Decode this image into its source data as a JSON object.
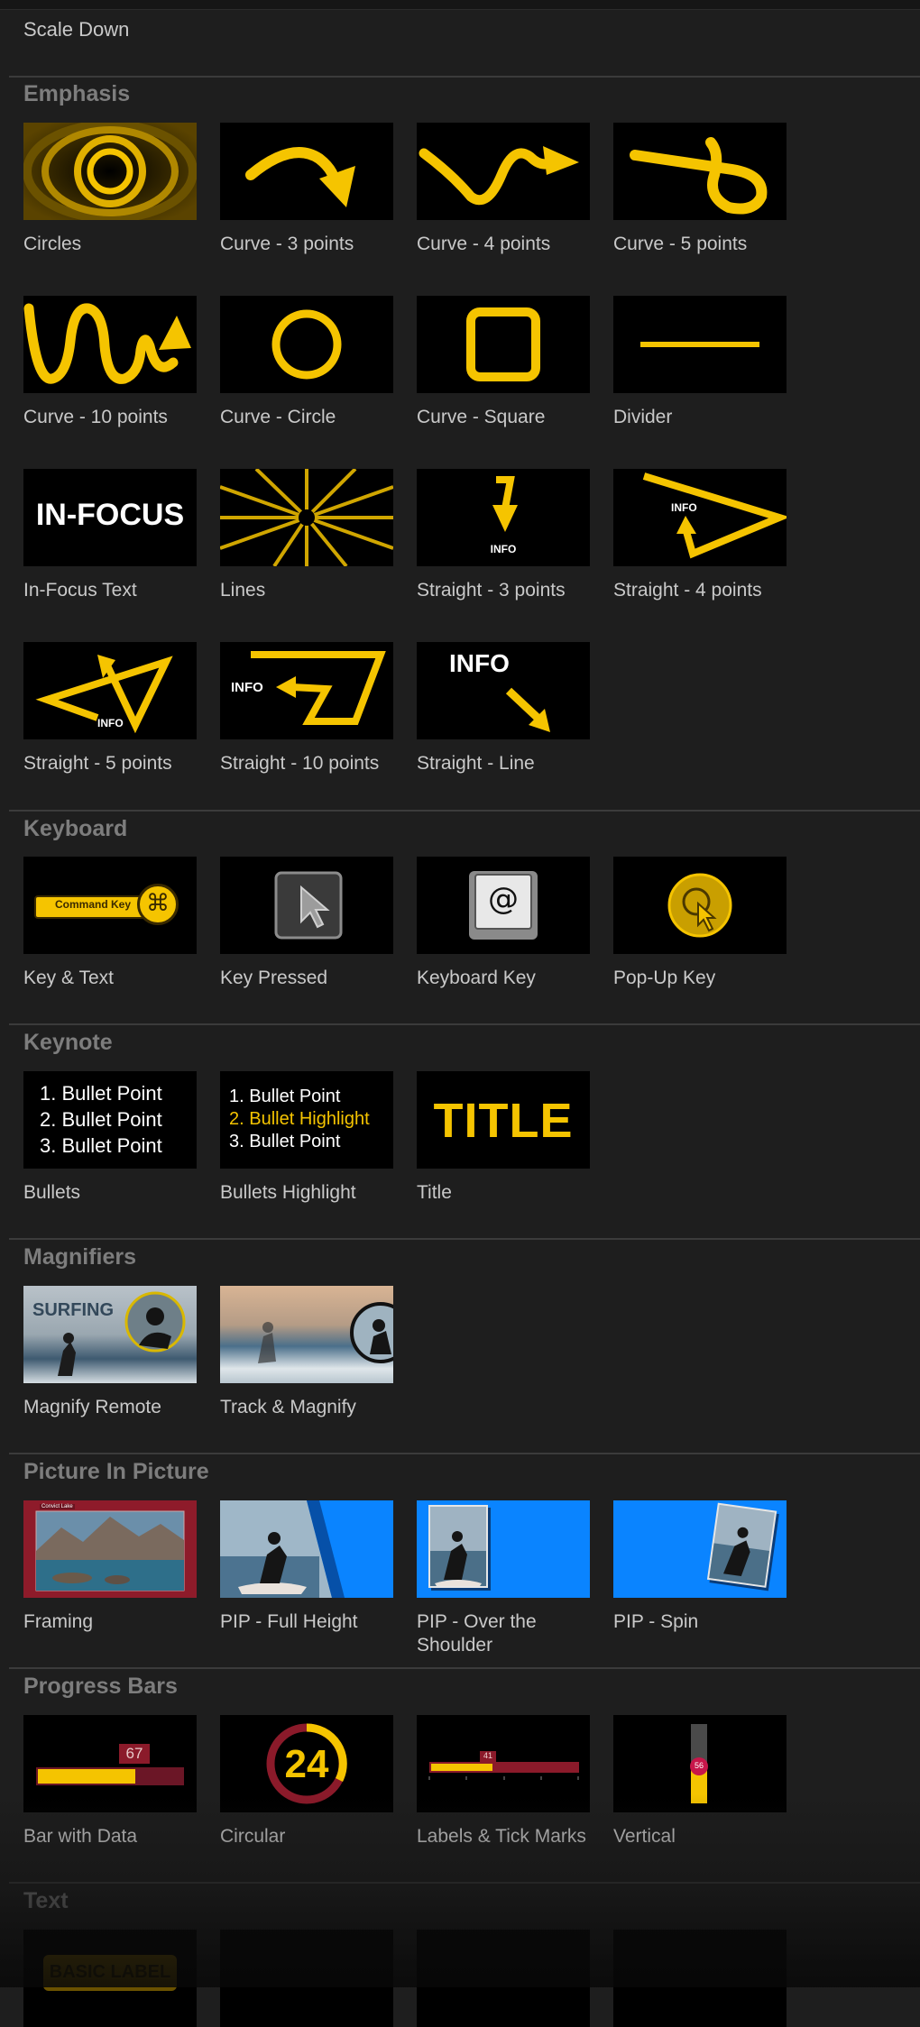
{
  "top_item": "Scale Down",
  "sections": {
    "emphasis": {
      "title": "Emphasis",
      "items": [
        "Circles",
        "Curve - 3 points",
        "Curve - 4 points",
        "Curve - 5 points",
        "Curve - 10 points",
        "Curve - Circle",
        "Curve - Square",
        "Divider",
        "In-Focus Text",
        "Lines",
        "Straight - 3 points",
        "Straight - 4 points",
        "Straight - 5 points",
        "Straight - 10 points",
        "Straight - Line"
      ]
    },
    "keyboard": {
      "title": "Keyboard",
      "items": [
        "Key & Text",
        "Key Pressed",
        "Keyboard Key",
        "Pop-Up Key"
      ]
    },
    "keynote": {
      "title": "Keynote",
      "items": [
        "Bullets",
        "Bullets Highlight",
        "Title"
      ]
    },
    "magnifiers": {
      "title": "Magnifiers",
      "items": [
        "Magnify Remote",
        "Track & Magnify"
      ]
    },
    "pip": {
      "title": "Picture In Picture",
      "items": [
        "Framing",
        "PIP - Full Height",
        "PIP - Over the Shoulder",
        "PIP - Spin"
      ]
    },
    "progress": {
      "title": "Progress Bars",
      "items": [
        "Bar with Data",
        "Circular",
        "Labels & Tick Marks",
        "Vertical"
      ]
    },
    "text": {
      "title": "Text"
    }
  },
  "thumb_text": {
    "in_focus": "IN-FOCUS",
    "info": "INFO",
    "command_key": "Command Key",
    "cmd_symbol": "⌘",
    "at_symbol": "@",
    "bullets": [
      "1. Bullet Point",
      "2. Bullet Point",
      "3. Bullet Point"
    ],
    "bullets_highlight": [
      "1. Bullet Point",
      "2. Bullet Highlight",
      "3. Bullet Point"
    ],
    "title": "TITLE",
    "surfing": "SURFING",
    "framing_tag": "Convict Lake",
    "bar_value": "67",
    "circular_value": "24",
    "ticks_value": "41",
    "vertical_value": "56",
    "basic_label": "BASIC LABEL"
  },
  "colors": {
    "background": "#1e1e1e",
    "accent": "#f5c400",
    "section": "#7d7d7d",
    "label": "#c9c9c9",
    "pip_blue": "#0a84ff",
    "framing_red": "#8e1b2a",
    "progress_red": "#8b1a2a"
  }
}
